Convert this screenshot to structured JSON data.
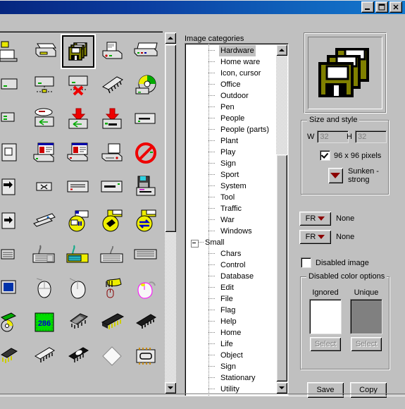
{
  "window": {
    "title": "",
    "buttons": {
      "minimize": "minimize",
      "maximize": "maximize",
      "close": "close"
    }
  },
  "icon_panel": {
    "name": "Image list",
    "selected_index": 2,
    "scrollbar": {
      "up": "scroll-up",
      "down": "scroll-down"
    },
    "icons": [
      {
        "name": "workstation-user"
      },
      {
        "name": "printer-laser"
      },
      {
        "name": "floppy-disk-stack"
      },
      {
        "name": "printer-inkjet"
      },
      {
        "name": "printer-wide"
      },
      {
        "name": "server-unit"
      },
      {
        "name": "network-computer"
      },
      {
        "name": "network-computer-disconnected"
      },
      {
        "name": "memory-chip-slanted"
      },
      {
        "name": "cd-rom-drive"
      },
      {
        "name": "router-side"
      },
      {
        "name": "hub-broadcast"
      },
      {
        "name": "hub-download-left"
      },
      {
        "name": "hub-download-right"
      },
      {
        "name": "modem-unit"
      },
      {
        "name": "scanner-panel"
      },
      {
        "name": "scanner-document-red"
      },
      {
        "name": "scanner-document-blue"
      },
      {
        "name": "scanner-flatbed"
      },
      {
        "name": "no-entry-forbidden"
      },
      {
        "name": "device-arrow"
      },
      {
        "name": "switch-small"
      },
      {
        "name": "fax-lines"
      },
      {
        "name": "modem-dark-bar"
      },
      {
        "name": "floppy-drive-unit"
      },
      {
        "name": "device-arrow-2"
      },
      {
        "name": "tape-drive"
      },
      {
        "name": "yellow-computer-badge"
      },
      {
        "name": "yellow-disk-badge"
      },
      {
        "name": "yellow-transfer-badge"
      },
      {
        "name": "keyboard-small"
      },
      {
        "name": "keyboard-corded"
      },
      {
        "name": "keyboard-highlighted"
      },
      {
        "name": "keyboard-plain"
      },
      {
        "name": "keyboard-flat"
      },
      {
        "name": "monitor-blue-screen"
      },
      {
        "name": "mouse-white"
      },
      {
        "name": "mouse-white-2"
      },
      {
        "name": "hand-mouse-pointer"
      },
      {
        "name": "mouse-pink-outline"
      },
      {
        "name": "cd-disc-stack"
      },
      {
        "name": "cpu-286"
      },
      {
        "name": "chip-socket"
      },
      {
        "name": "chip-gold-pins"
      },
      {
        "name": "chip-dip-black"
      },
      {
        "name": "chip-yellow-legs"
      },
      {
        "name": "chip-white-body"
      },
      {
        "name": "chip-black-oval"
      },
      {
        "name": "diamond-outline"
      },
      {
        "name": "chip-square-pins"
      }
    ]
  },
  "tree": {
    "label": "Image categories",
    "selected": "Hardware",
    "items": [
      {
        "label": "Hardware",
        "level": 1
      },
      {
        "label": "Home ware",
        "level": 1
      },
      {
        "label": "Icon, cursor",
        "level": 1
      },
      {
        "label": "Office",
        "level": 1
      },
      {
        "label": "Outdoor",
        "level": 1
      },
      {
        "label": "Pen",
        "level": 1
      },
      {
        "label": "People",
        "level": 1
      },
      {
        "label": "People (parts)",
        "level": 1
      },
      {
        "label": "Plant",
        "level": 1
      },
      {
        "label": "Play",
        "level": 1
      },
      {
        "label": "Sign",
        "level": 1
      },
      {
        "label": "Sport",
        "level": 1
      },
      {
        "label": "System",
        "level": 1
      },
      {
        "label": "Tool",
        "level": 1
      },
      {
        "label": "Traffic",
        "level": 1
      },
      {
        "label": "War",
        "level": 1
      },
      {
        "label": "Windows",
        "level": 1
      },
      {
        "label": "Small",
        "level": 0,
        "expander": "collapse"
      },
      {
        "label": "Chars",
        "level": 1
      },
      {
        "label": "Control",
        "level": 1
      },
      {
        "label": "Database",
        "level": 1
      },
      {
        "label": "Edit",
        "level": 1
      },
      {
        "label": "File",
        "level": 1
      },
      {
        "label": "Flag",
        "level": 1
      },
      {
        "label": "Help",
        "level": 1
      },
      {
        "label": "Home",
        "level": 1
      },
      {
        "label": "Life",
        "level": 1
      },
      {
        "label": "Object",
        "level": 1
      },
      {
        "label": "Sign",
        "level": 1
      },
      {
        "label": "Stationary",
        "level": 1
      },
      {
        "label": "Utility",
        "level": 1
      }
    ]
  },
  "preview": {
    "name": "floppy-disk-stack-preview",
    "colors": {
      "body": "#808000",
      "sheet": "#ffffff",
      "shutter": "#000000"
    }
  },
  "size_and_style": {
    "legend": "Size and style",
    "width_label": "W",
    "width_value": "32",
    "height_label": "H",
    "height_value": "32",
    "pixels_checkbox": {
      "label": "96 x 96 pixels",
      "checked": true
    },
    "style_label": "Sunken - strong",
    "style_arrow_color": "#8b0000"
  },
  "frames": [
    {
      "button_label": "FR",
      "value": "None"
    },
    {
      "button_label": "FR",
      "value": "None"
    }
  ],
  "disabled_image": {
    "label": "Disabled image",
    "checked": false
  },
  "disabled_color_options": {
    "legend": "Disabled color options",
    "ignored": {
      "label": "Ignored",
      "color": "#ffffff",
      "button": "Select"
    },
    "unique": {
      "label": "Unique",
      "color": "#808080",
      "button": "Select"
    }
  },
  "actions": {
    "save": "Save",
    "copy": "Copy"
  }
}
